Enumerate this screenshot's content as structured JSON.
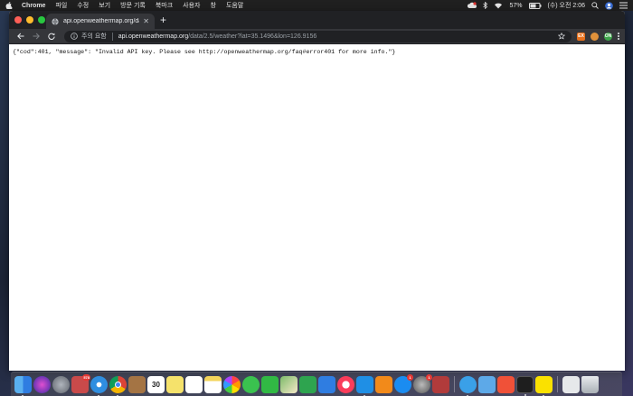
{
  "menubar": {
    "app_name": "Chrome",
    "items": [
      "파일",
      "수정",
      "보기",
      "방문 기록",
      "북마크",
      "사용자",
      "창",
      "도움말"
    ],
    "battery": "57%",
    "clock": "(수) 오전 2:06"
  },
  "browser": {
    "tab_title": "api.openweathermap.org/data/",
    "security_label": "주의 요함",
    "url_host": "api.openweathermap.org",
    "url_path": "/data/2.5/weather?lat=35.1496&lon=126.9156",
    "extensions": [
      {
        "name": "ext-orange-icon",
        "label": "EX"
      },
      {
        "name": "ext-round-icon",
        "label": ""
      },
      {
        "name": "ext-green-icon",
        "label": "ON"
      }
    ]
  },
  "page": {
    "body_text": "{\"cod\":401, \"message\": \"Invalid API key. Please see http://openweathermap.org/faq#error401 for more info.\"}"
  },
  "dock": {
    "badges": {
      "photos": "578",
      "calendar_day": "30",
      "appstore": "1",
      "sysprefs": "1"
    },
    "colors": {
      "finder": "#4a90e2",
      "siri": "#6a3de8",
      "launchpad": "#8a8f98",
      "photos_app": "#c94a4a",
      "safari": "#2f8ee0",
      "chrome": "#ffffff",
      "notes_brown": "#a47444",
      "calendar": "#ffffff",
      "stickies": "#f5e26b",
      "reminders": "#ffffff",
      "photos": "#f2f2f2",
      "messages": "#3ac24f",
      "facetime": "#31b944",
      "maps": "#7dbb6a",
      "numbers": "#2ea44f",
      "keynote": "#2f7de1",
      "music": "#fa3c5a",
      "vscode": "#1f8fe5",
      "books": "#f28a1a",
      "appstore": "#1a8cf1",
      "sysprefs": "#7b7b7b",
      "screenshot": "#b13b3b",
      "finder2": "#3aa0e8",
      "xcode_like": "#5da9e8",
      "swift": "#f05138",
      "terminal": "#1e1e1e",
      "kakaotalk": "#fae100",
      "trash": "#cfd3d8"
    }
  }
}
